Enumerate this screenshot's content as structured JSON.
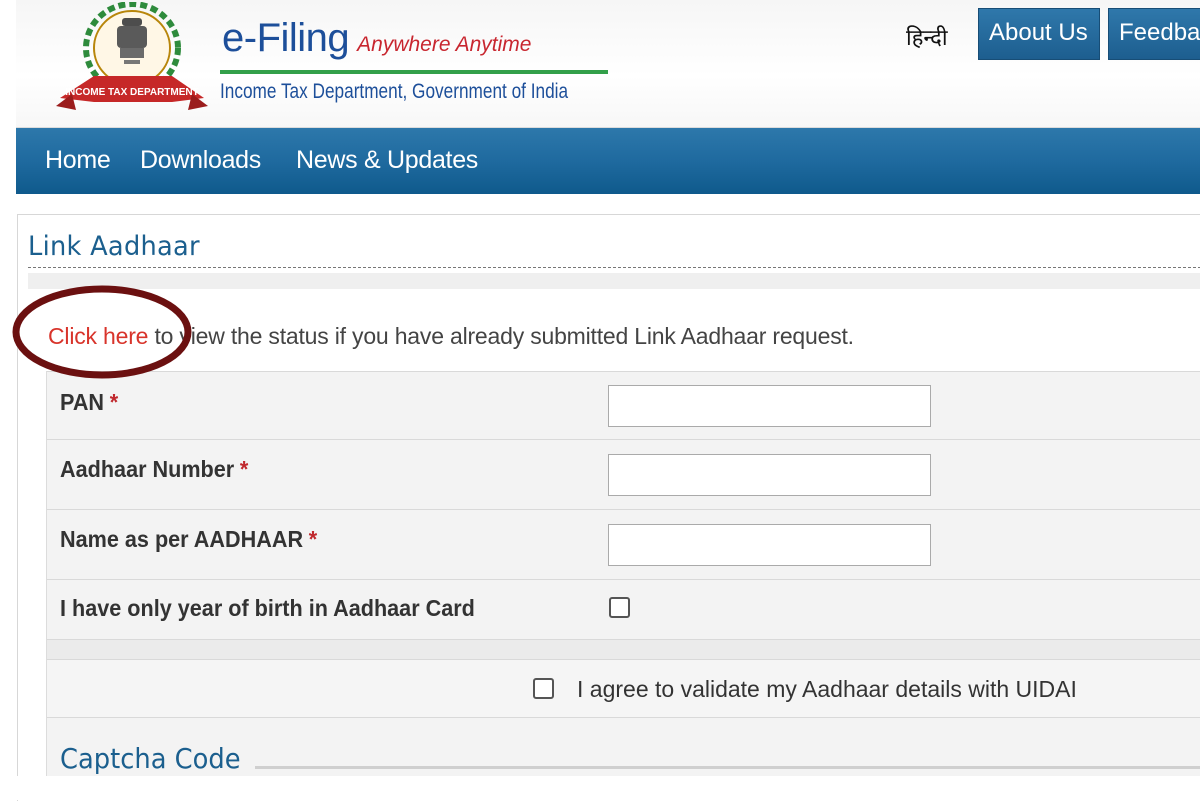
{
  "header": {
    "emblem_icon": "income-tax-department-emblem",
    "brand_main": "e-Filing",
    "brand_tagline": "Anywhere Anytime",
    "brand_subtitle": "Income Tax Department, Government of India",
    "emblem_ribbon_text": "INCOME TAX DEPARTMENT",
    "language_link": "हिन्दी",
    "about_button": "About Us",
    "feedback_button": "Feedba"
  },
  "nav": {
    "items": [
      "Home",
      "Downloads",
      "News & Updates"
    ]
  },
  "panel": {
    "title": "Link Aadhaar",
    "status_link": "Click here",
    "status_text": " to view the status if you have already submitted Link Aadhaar request."
  },
  "form": {
    "pan_label": "PAN",
    "aadhaar_label": "Aadhaar Number",
    "name_label": "Name as per AADHAAR",
    "required_marker": "*",
    "pan_value": "",
    "aadhaar_value": "",
    "name_value": "",
    "year_of_birth_label": "I have only year of birth in Aadhaar Card",
    "year_of_birth_checked": false,
    "agree_label": "I agree to validate my Aadhaar details with UIDAI",
    "agree_checked": false,
    "captcha_title": "Captcha Code"
  },
  "colors": {
    "brand_blue": "#1d4f9a",
    "nav_blue": "#1f6a9f",
    "link_red": "#d8342b",
    "annotation_ellipse": "#6b1010"
  }
}
